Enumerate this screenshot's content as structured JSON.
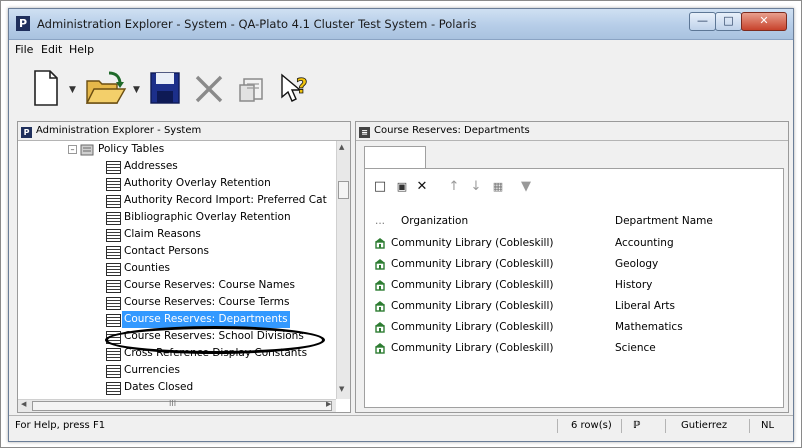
{
  "window": {
    "title": "Administration Explorer - System - QA-Plato 4.1 Cluster Test System - Polaris",
    "app_icon": "P",
    "controls": [
      "minimize-icon",
      "maximize-icon",
      "close-icon"
    ]
  },
  "menu": {
    "items": [
      "File",
      "Edit",
      "Help"
    ]
  },
  "toolbar": {
    "icons": [
      "new-document-icon",
      "open-folder-icon",
      "save-icon",
      "delete-icon",
      "properties-icon",
      "help-icon"
    ]
  },
  "left_pane": {
    "header": "Administration Explorer - System",
    "tree_parent": "Policy Tables",
    "tree_items": [
      "Addresses",
      "Authority Overlay Retention",
      "Authority Record Import: Preferred Cat",
      "Bibliographic Overlay Retention",
      "Claim Reasons",
      "Contact Persons",
      "Counties",
      "Course Reserves: Course Names",
      "Course Reserves: Course Terms",
      "Course Reserves: Departments",
      "Course Reserves: School Divisions",
      "Cross Reference Display Constants",
      "Currencies",
      "Dates Closed"
    ],
    "selected_item": "Course Reserves: Departments",
    "hscroll_mark": "III"
  },
  "right_pane": {
    "header": "Course Reserves: Departments",
    "tools": [
      "new-icon",
      "view-icon",
      "delete-icon",
      "move-up-icon",
      "move-down-icon",
      "insert-icon",
      "filter-icon"
    ],
    "columns": {
      "marker": "...",
      "organization": "Organization",
      "department": "Department Name"
    },
    "rows": [
      {
        "organization": "Community Library (Cobleskill)",
        "department": "Accounting"
      },
      {
        "organization": "Community Library (Cobleskill)",
        "department": "Geology"
      },
      {
        "organization": "Community Library (Cobleskill)",
        "department": "History"
      },
      {
        "organization": "Community Library (Cobleskill)",
        "department": "Liberal Arts"
      },
      {
        "organization": "Community Library (Cobleskill)",
        "department": "Mathematics"
      },
      {
        "organization": "Community Library (Cobleskill)",
        "department": "Science"
      }
    ]
  },
  "status": {
    "help": "For Help, press F1",
    "rows": "6 row(s)",
    "user": "Gutierrez",
    "mode": "NL"
  },
  "colors": {
    "selection": "#3399ff",
    "accent": "#1f2f5c",
    "titlebar": "#b6cde8"
  }
}
